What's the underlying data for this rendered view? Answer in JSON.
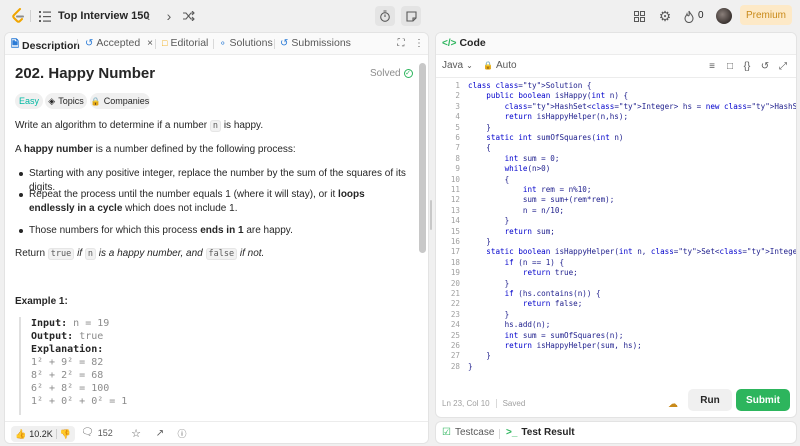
{
  "topbar": {
    "list_title": "Top Interview 150",
    "streak_count": "0",
    "premium_label": "Premium"
  },
  "left_panel": {
    "tabs": [
      {
        "label": "Description"
      },
      {
        "label": "Accepted"
      },
      {
        "label": "Editorial"
      },
      {
        "label": "Solutions"
      },
      {
        "label": "Submissions"
      }
    ],
    "problem_title": "202. Happy Number",
    "solved_label": "Solved",
    "difficulty": "Easy",
    "topics_label": "Topics",
    "companies_label": "Companies",
    "intro_1": "Write an algorithm to determine if a number",
    "intro_code": "n",
    "intro_2": "is happy.",
    "def_1": "A",
    "def_bold": "happy number",
    "def_2": "is a number defined by the following process:",
    "bullet_1": "Starting with any positive integer, replace the number by the sum of the squares of its digits.",
    "bullet_2_a": "Repeat the process until the number equals 1 (where it will stay), or it",
    "bullet_2_bold": "loops endlessly in a cycle",
    "bullet_2_b": "which does not include 1.",
    "bullet_3_a": "Those numbers for which this process",
    "bullet_3_bold": "ends in 1",
    "bullet_3_b": "are happy.",
    "return_1": "Return",
    "return_code_true": "true",
    "return_2": "if",
    "return_code_n": "n",
    "return_3": "is a happy number, and",
    "return_code_false": "false",
    "return_4": "if not.",
    "example_heading": "Example 1:",
    "example_input_key": "Input:",
    "example_input_val": "n = 19",
    "example_output_key": "Output:",
    "example_output_val": "true",
    "example_expl_key": "Explanation:",
    "example_lines": [
      "1² + 9² = 82",
      "8² + 2² = 68",
      "6² + 8² = 100",
      "1² + 0² + 0² = 1"
    ],
    "likes": "10.2K",
    "comments": "152"
  },
  "right_panel": {
    "title": "Code",
    "language": "Java",
    "auto_label": "Auto",
    "status_position": "Ln 23, Col 10",
    "status_saved": "Saved",
    "run_label": "Run",
    "submit_label": "Submit",
    "testcase_label": "Testcase",
    "test_result_label": "Test Result"
  },
  "code_lines": [
    "class Solution {",
    "    public boolean isHappy(int n) {",
    "        HashSet<Integer> hs = new HashSet<Integer>();",
    "        return isHappyHelper(n,hs);",
    "    }",
    "    static int sumOfSquares(int n)",
    "    {",
    "        int sum = 0;",
    "        while(n>0)",
    "        {",
    "            int rem = n%10;",
    "            sum = sum+(rem*rem);",
    "            n = n/10;",
    "        }",
    "        return sum;",
    "    }",
    "    static boolean isHappyHelper(int n, Set<Integer> hs) {",
    "        if (n == 1) {",
    "            return true;",
    "        }",
    "        if (hs.contains(n)) {",
    "            return false;",
    "        }",
    "        hs.add(n);",
    "        int sum = sumOfSquares(n);",
    "        return isHappyHelper(sum, hs);",
    "    }",
    "}"
  ],
  "colors": {
    "accent_green": "#2db55d",
    "premium_bg": "#fde9c7",
    "premium_text": "#c98a1a",
    "easy_text": "#00b8a3"
  }
}
